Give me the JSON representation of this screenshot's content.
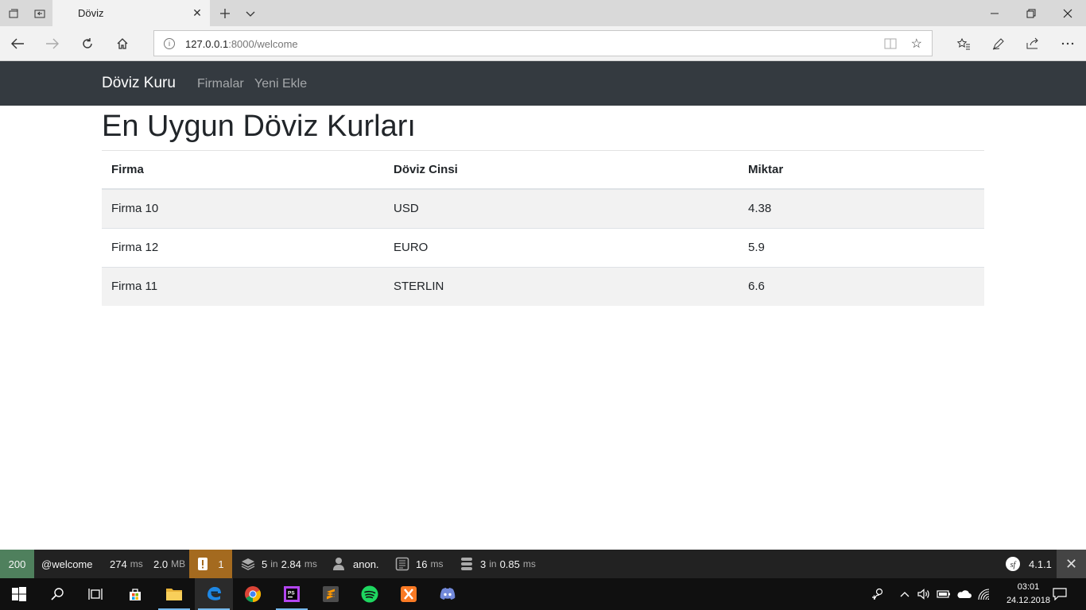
{
  "browser": {
    "tab_title": "Döviz",
    "url_main": "127.0.0.1",
    "url_rest": ":8000/welcome"
  },
  "site": {
    "brand": "Döviz Kuru",
    "nav": [
      "Firmalar",
      "Yeni Ekle"
    ]
  },
  "page": {
    "heading": "En Uygun Döviz Kurları",
    "table": {
      "headers": [
        "Firma",
        "Döviz Cinsi",
        "Miktar"
      ],
      "rows": [
        [
          "Firma 10",
          "USD",
          "4.38"
        ],
        [
          "Firma 12",
          "EURO",
          "5.9"
        ],
        [
          "Firma 11",
          "STERLIN",
          "6.6"
        ]
      ]
    }
  },
  "debug_toolbar": {
    "status": "200",
    "route": "@welcome",
    "time_value": "274",
    "time_unit": "ms",
    "memory_value": "2.0",
    "memory_unit": "MB",
    "warnings": "1",
    "layers_count": "5",
    "layers_in": "in",
    "layers_time": "2.84",
    "layers_unit": "ms",
    "user": "anon.",
    "render_value": "16",
    "render_unit": "ms",
    "db_count": "3",
    "db_in": "in",
    "db_time": "0.85",
    "db_unit": "ms",
    "version": "4.1.1"
  },
  "taskbar": {
    "time": "03:01",
    "date": "24.12.2018"
  }
}
